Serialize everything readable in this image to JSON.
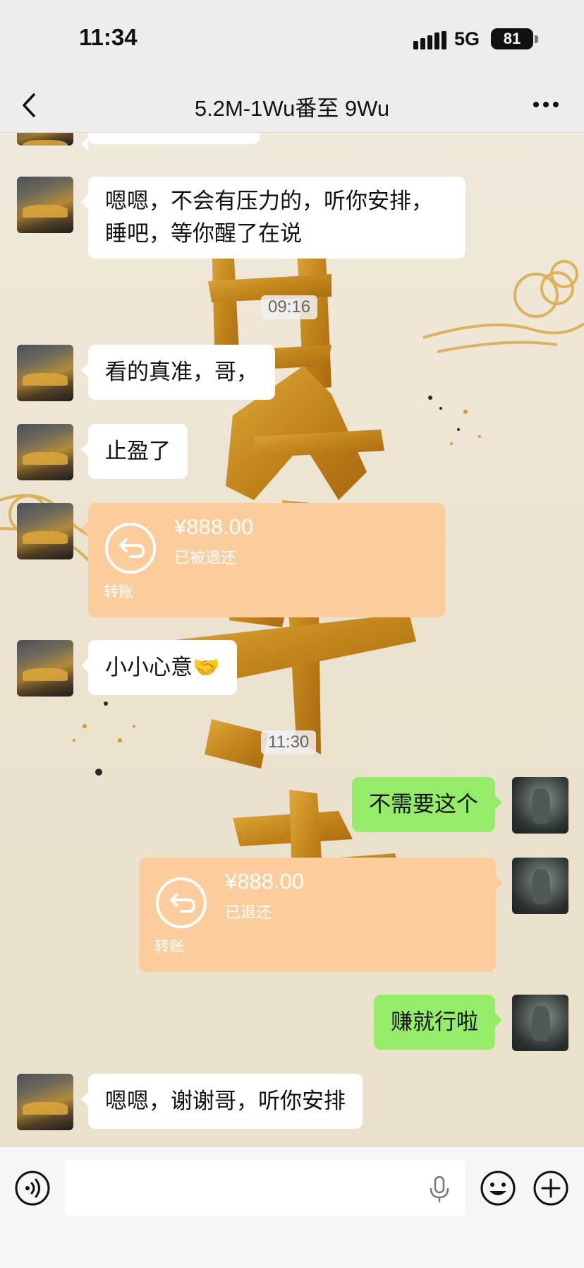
{
  "status_bar": {
    "time": "11:34",
    "network": "5G",
    "battery": "81"
  },
  "nav": {
    "title": "5.2M-1Wu番至 9Wu"
  },
  "messages": {
    "m1": "嗯嗯，不会有压力的，听你安排，",
    "m1_line2": "睡吧，等你醒了在说",
    "ts1": "09:16",
    "m2": "看的真准，哥，",
    "m3": "止盈了",
    "transfer1": {
      "amount": "¥888.00",
      "status": "已被退还",
      "label": "转账"
    },
    "m4": "小小心意🤝",
    "ts2": "11:30",
    "m5": "不需要这个",
    "transfer2": {
      "amount": "¥888.00",
      "status": "已退还",
      "label": "转账"
    },
    "m6": "赚就行啦",
    "m7": "嗯嗯，谢谢哥，听你安排"
  },
  "colors": {
    "green_bubble": "#95ec69",
    "transfer_bubble": "#fbcd9c",
    "gold_art": "#c98f1e"
  },
  "icons": [
    "back-icon",
    "more-icon",
    "voice-icon",
    "mic-icon",
    "emoji-icon",
    "plus-icon",
    "return-arrow-icon",
    "signal-icon"
  ]
}
